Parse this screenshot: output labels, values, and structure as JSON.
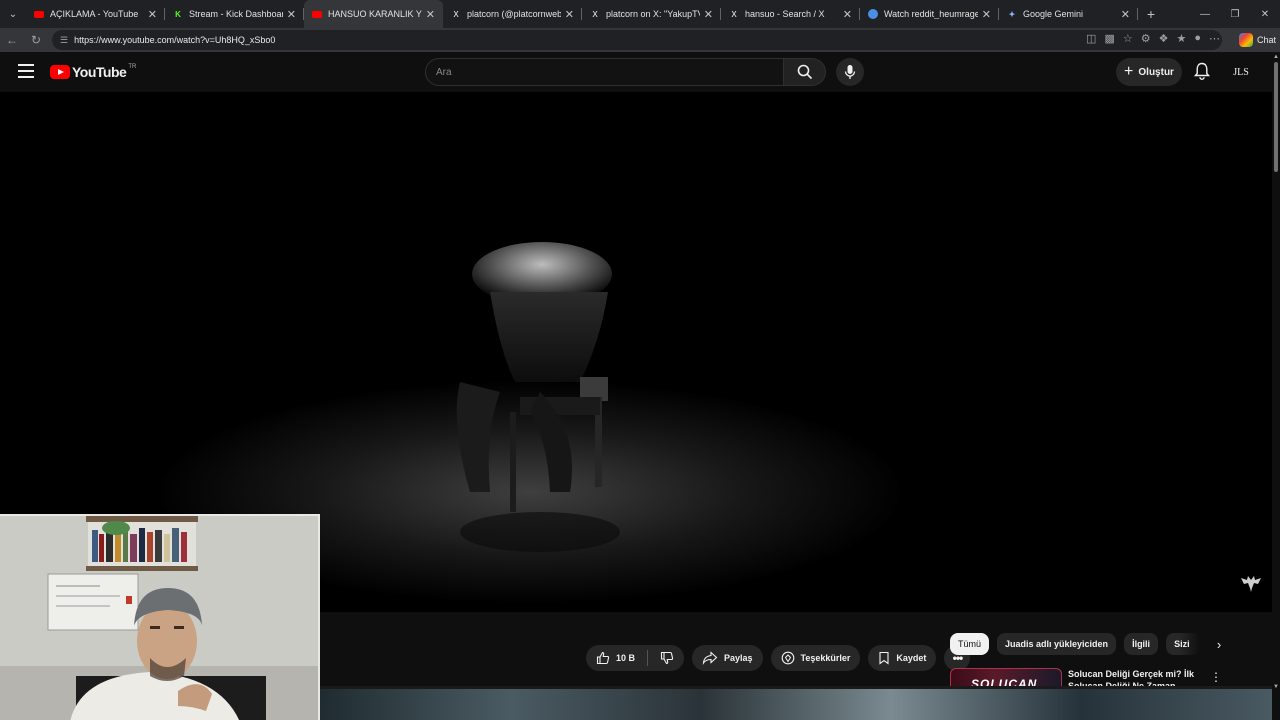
{
  "browser": {
    "tabs": [
      {
        "title": "AÇIKLAMA - YouTube",
        "favicon": "youtube-icon",
        "color": "#ff0000",
        "active": false
      },
      {
        "title": "Stream - Kick Dashboard",
        "favicon": "kick-icon",
        "color": "#53fc18",
        "active": false
      },
      {
        "title": "HANSUO KARANLIK YÜZÜ",
        "favicon": "youtube-icon",
        "color": "#ff0000",
        "active": true
      },
      {
        "title": "platcorn (@platcornweb) / X",
        "favicon": "x-icon",
        "color": "#ffffff",
        "active": false
      },
      {
        "title": "platcorn on X: \"YakupTV, Gr",
        "favicon": "x-icon",
        "color": "#ffffff",
        "active": false
      },
      {
        "title": "hansuo - Search / X",
        "favicon": "x-icon",
        "color": "#ffffff",
        "active": false
      },
      {
        "title": "Watch reddit_heumragelfsan",
        "favicon": "reddit-icon",
        "color": "#4a90e2",
        "active": false
      },
      {
        "title": "Google Gemini",
        "favicon": "gemini-icon",
        "color": "#8ab4f8",
        "active": false
      }
    ],
    "url": "https://www.youtube.com/watch?v=Uh8HQ_xSbo0",
    "chat_label": "Chat"
  },
  "youtube": {
    "logo_text": "YouTube",
    "logo_country": "TR",
    "search_placeholder": "Ara",
    "create_label": "Oluştur",
    "avatar_initials": "JLS",
    "accent": "#ff0000"
  },
  "video_actions": {
    "like_count": "10 B",
    "share_label": "Paylaş",
    "thanks_label": "Teşekkürler",
    "save_label": "Kaydet"
  },
  "chips": [
    {
      "label": "Tümü",
      "active": true
    },
    {
      "label": "Juadis adlı yükleyiciden",
      "active": false
    },
    {
      "label": "İlgili",
      "active": false
    },
    {
      "label": "Sizi",
      "active": false
    }
  ],
  "recommendation": {
    "title": "Solucan Deliği Gerçek mi? İlk Solucan Deliği Ne Zaman",
    "thumb_text": "SOLUCAN"
  }
}
